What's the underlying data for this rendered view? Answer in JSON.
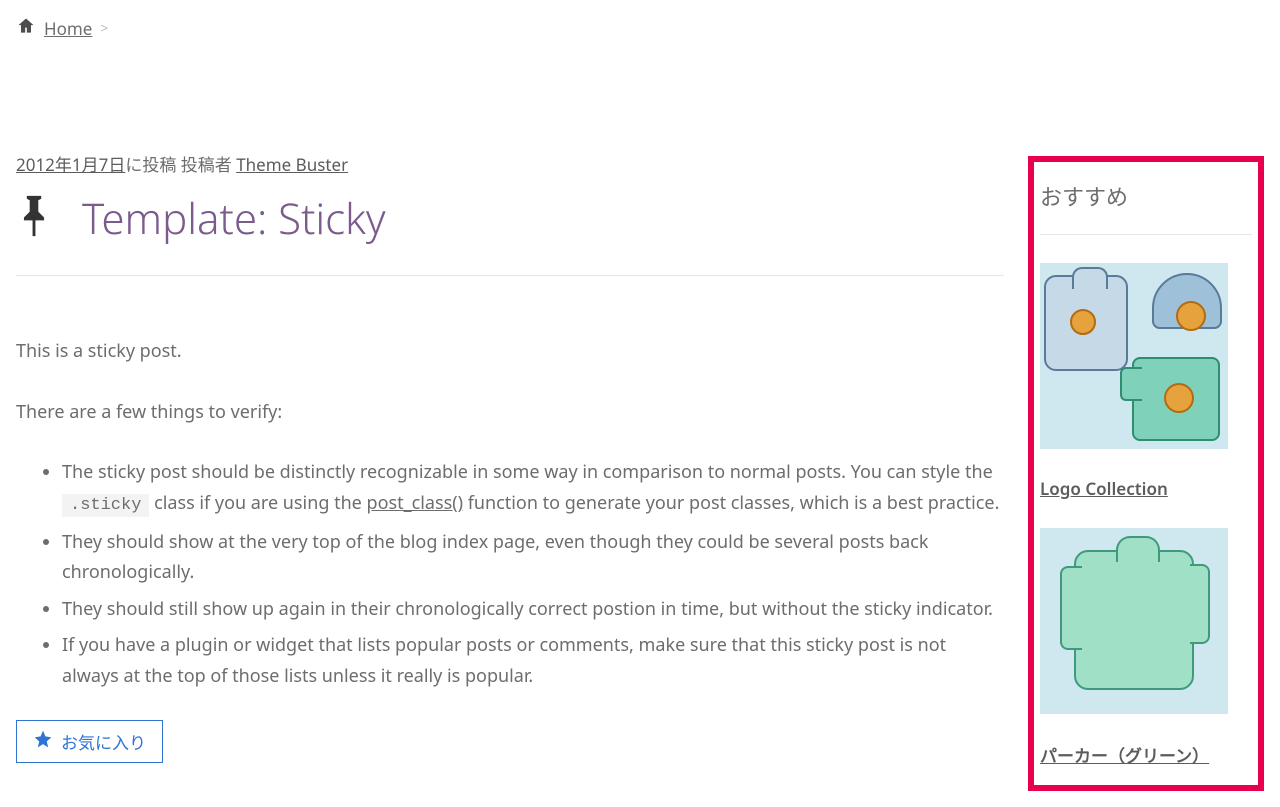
{
  "breadcrumb": {
    "home": "Home",
    "sep": ">"
  },
  "meta": {
    "date": "2012年1月7日",
    "text1": "に投稿 投稿者 ",
    "author": "Theme Buster"
  },
  "title": "Template: Sticky",
  "content": {
    "p1": "This is a sticky post.",
    "p2": "There are a few things to verify:",
    "li1a": "The sticky post should be distinctly recognizable in some way in comparison to normal posts. You can style the ",
    "li1_code": ".sticky",
    "li1b": " class if you are using the ",
    "li1_link": "post_class()",
    "li1c": " function to generate your post classes, which is a best practice.",
    "li2": "They should show at the very top of the blog index page, even though they could be several posts back chronologically.",
    "li3": "They should still show up again in their chronologically correct postion in time, but without the sticky indicator.",
    "li4": "If you have a plugin or widget that lists popular posts or comments, make sure that this sticky post is not always at the top of those lists unless it really is popular."
  },
  "favorite": "お気に入り",
  "sidebar": {
    "title": "おすすめ",
    "products": [
      {
        "name": "Logo Collection"
      },
      {
        "name": "パーカー（グリーン）"
      }
    ]
  }
}
